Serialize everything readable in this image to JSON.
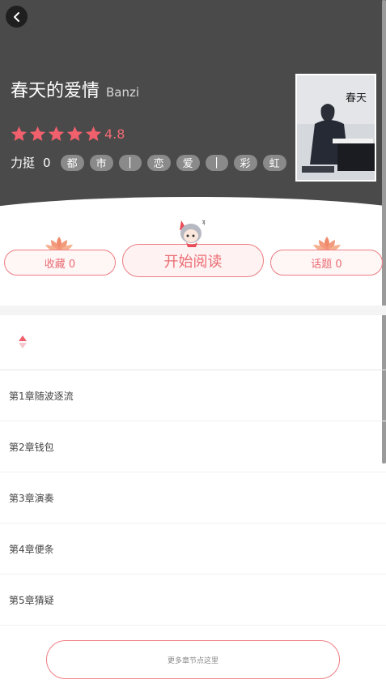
{
  "book": {
    "title": "春天的爱情",
    "author": "Banzi",
    "rating": "4.8",
    "push_label": "力挺",
    "push_count": "0",
    "tags": [
      "都",
      "市",
      "|",
      "恋",
      "爱",
      "|",
      "彩",
      "虹"
    ],
    "cover_text": "春天"
  },
  "actions": {
    "favorite": "收藏 0",
    "start_reading": "开始阅读",
    "topic": "话题 0"
  },
  "chapters": [
    "第1章随波逐流",
    "第2章钱包",
    "第3章演奏",
    "第4章便条",
    "第5章猜疑"
  ],
  "more_chapters": "更多章节点这里",
  "icons": {
    "back": "chevron-left-icon",
    "star": "star-icon",
    "sort": "sort-icon",
    "lotus": "lotus-icon",
    "mascot": "mascot-icon"
  },
  "colors": {
    "accent": "#ea6d74",
    "header_bg": "#4a4a4a",
    "tag_bg": "#8a8a8a"
  }
}
